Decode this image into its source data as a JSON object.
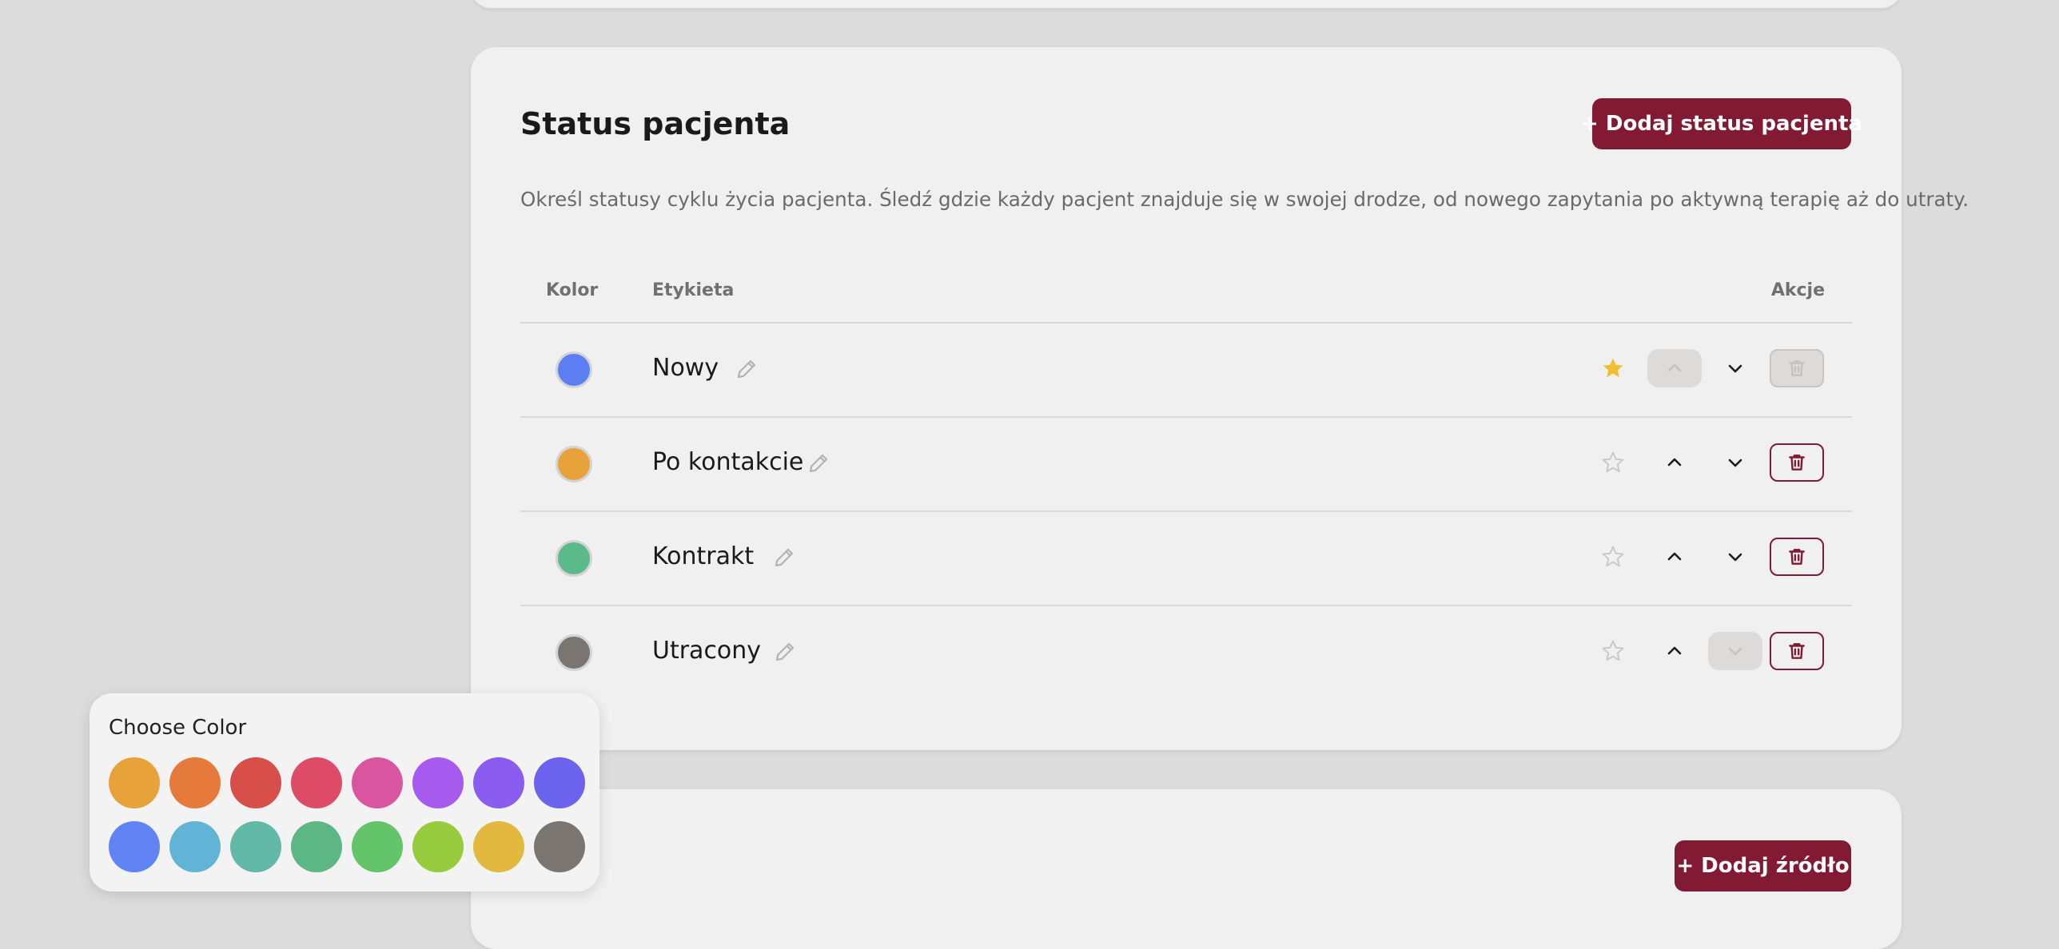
{
  "status_section": {
    "title": "Status pacjenta",
    "add_button": "+ Dodaj status pacjenta",
    "description": "Określ statusy cyklu życia pacjenta. Śledź gdzie każdy pacjent znajduje się w swojej drodze, od nowego zapytania po aktywną terapię aż do utraty.",
    "columns": {
      "color": "Kolor",
      "label": "Etykieta",
      "actions": "Akcje"
    },
    "rows": [
      {
        "label": "Nowy",
        "color": "#5b7ff2",
        "starred": true,
        "up_disabled": true,
        "down_disabled": false,
        "delete_disabled": true
      },
      {
        "label": "Po kontakcie",
        "color": "#e8a23a",
        "starred": false,
        "up_disabled": false,
        "down_disabled": false,
        "delete_disabled": false
      },
      {
        "label": "Kontrakt",
        "color": "#5bb98a",
        "starred": false,
        "up_disabled": false,
        "down_disabled": false,
        "delete_disabled": false
      },
      {
        "label": "Utracony",
        "color": "#7a7570",
        "starred": false,
        "up_disabled": false,
        "down_disabled": true,
        "delete_disabled": false
      }
    ],
    "icons": {
      "edit": "pencil-icon",
      "star": "star-icon",
      "up": "chevron-up-icon",
      "down": "chevron-down-icon",
      "delete": "trash-icon"
    }
  },
  "source_section": {
    "add_button": "+ Dodaj źródło"
  },
  "color_picker": {
    "title": "Choose Color",
    "colors": [
      "#e8a23a",
      "#e57a3a",
      "#d84f4a",
      "#de4b66",
      "#d955a0",
      "#a65aee",
      "#8a5cf0",
      "#6b63ee",
      "#6283f3",
      "#62b4d6",
      "#62b9a8",
      "#5db784",
      "#64c46a",
      "#97cb3e",
      "#e2b83e",
      "#7a7570"
    ]
  },
  "accent_color": "#821a33"
}
